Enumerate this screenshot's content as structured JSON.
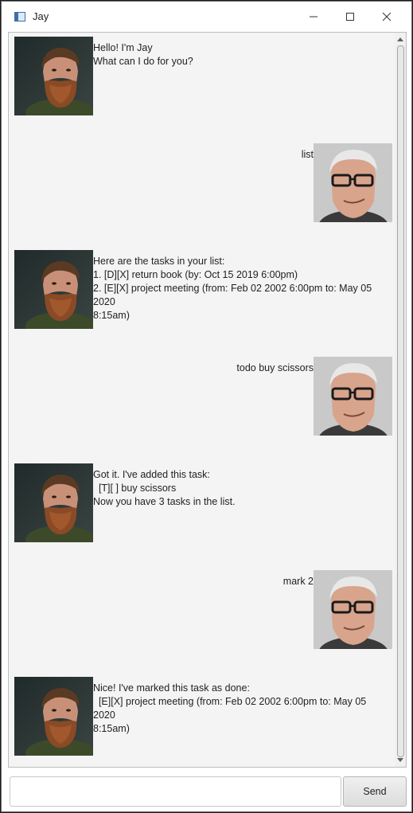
{
  "window": {
    "title": "Jay"
  },
  "conversation": [
    {
      "speaker": "bot",
      "text": "Hello! I'm Jay\nWhat can I do for you?"
    },
    {
      "speaker": "user",
      "text": "list"
    },
    {
      "speaker": "bot",
      "text": "Here are the tasks in your list:\n1. [D][X] return book (by: Oct 15 2019 6:00pm)\n2. [E][X] project meeting (from: Feb 02 2002 6:00pm to: May 05 2020\n8:15am)"
    },
    {
      "speaker": "user",
      "text": "todo buy scissors"
    },
    {
      "speaker": "bot",
      "text": "Got it. I've added this task:\n  [T][ ] buy scissors\nNow you have 3 tasks in the list."
    },
    {
      "speaker": "user",
      "text": "mark 2"
    },
    {
      "speaker": "bot",
      "text": "Nice! I've marked this task as done:\n  [E][X] project meeting (from: Feb 02 2002 6:00pm to: May 05 2020\n8:15am)"
    }
  ],
  "input": {
    "value": "",
    "send_label": "Send"
  },
  "colors": {
    "chat_background": "#f4f4f4",
    "window_background": "#ffffff",
    "text": "#1f1f1f"
  },
  "icons": {
    "minimize": "minimize-icon",
    "maximize": "maximize-icon",
    "close": "close-icon"
  }
}
